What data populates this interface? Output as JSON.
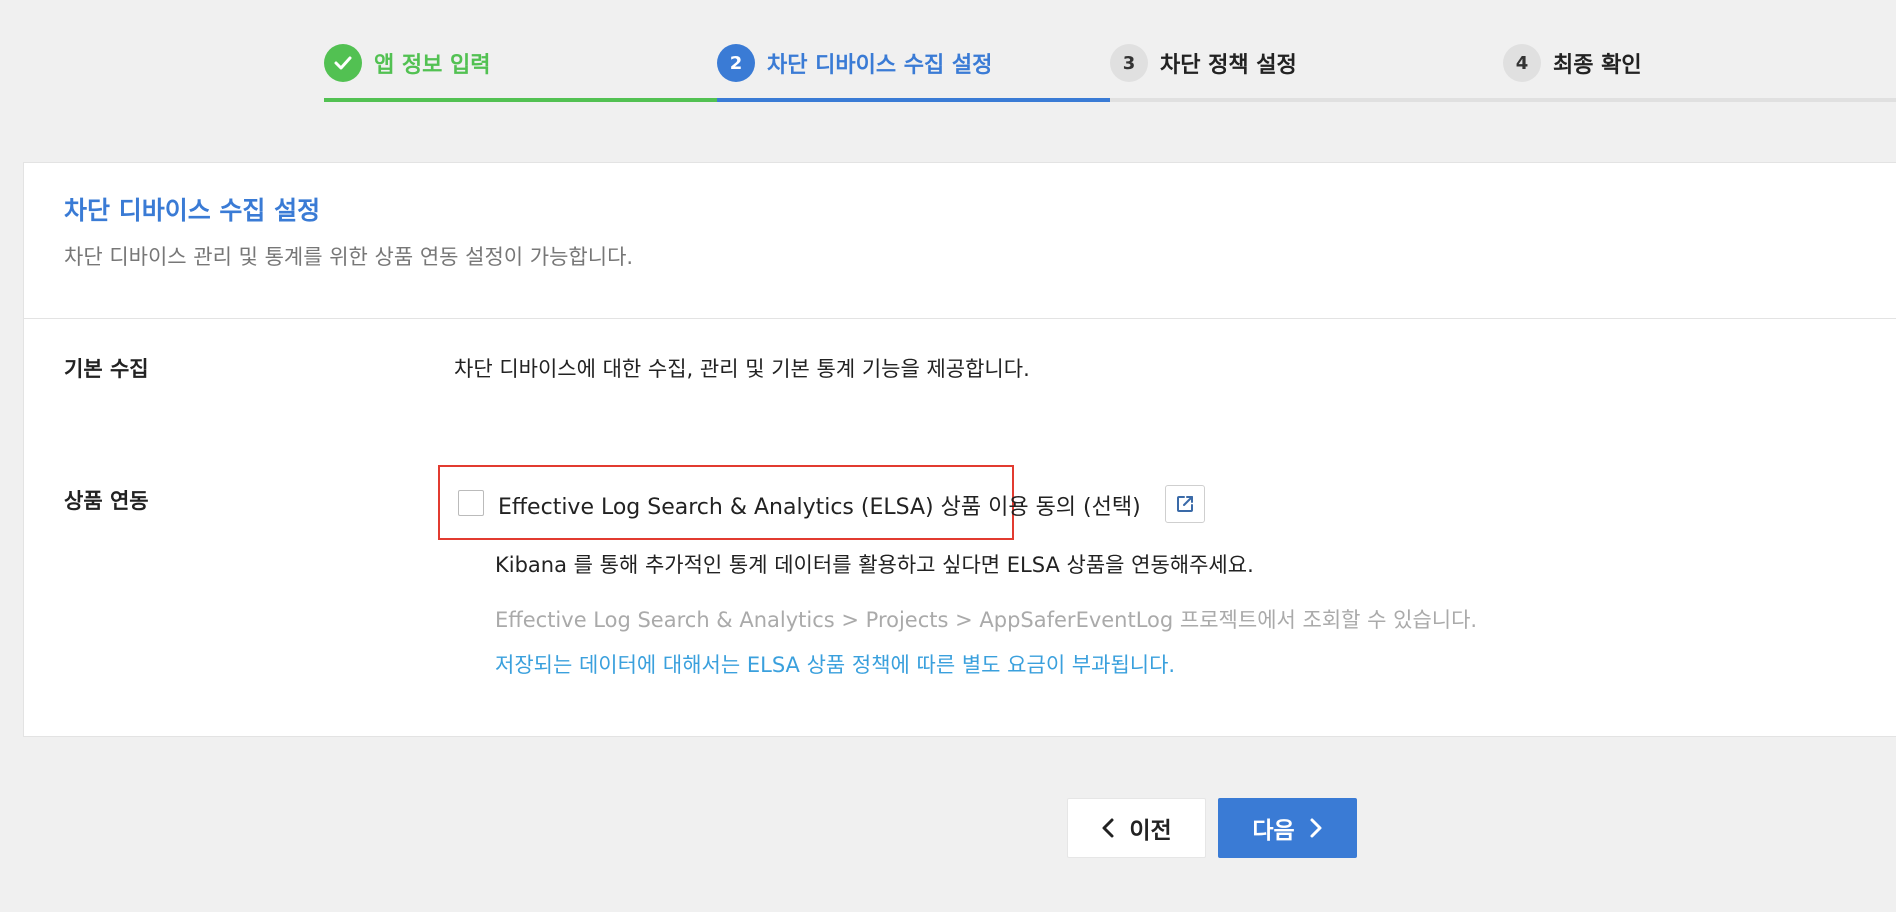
{
  "stepper": {
    "steps": [
      {
        "number": "1",
        "label": "앱 정보 입력",
        "state": "done"
      },
      {
        "number": "2",
        "label": "차단 디바이스 수집 설정",
        "state": "active"
      },
      {
        "number": "3",
        "label": "차단 정책 설정",
        "state": "pending"
      },
      {
        "number": "4",
        "label": "최종 확인",
        "state": "pending"
      }
    ]
  },
  "card": {
    "title": "차단 디바이스 수집 설정",
    "description": "차단 디바이스 관리 및 통계를 위한 상품 연동 설정이 가능합니다.",
    "basic": {
      "label": "기본 수집",
      "text": "차단 디바이스에 대한 수집, 관리 및 기본 통계 기능을 제공합니다."
    },
    "integration": {
      "label": "상품 연동",
      "consent_label": "Effective Log Search & Analytics (ELSA) 상품 이용 동의 (선택)",
      "consent_checked": false,
      "kibana_text": "Kibana 를 통해 추가적인 통계 데이터를 활용하고 싶다면 ELSA 상품을 연동해주세요.",
      "path_text": "Effective Log Search & Analytics > Projects > AppSaferEventLog 프로젝트에서 조회할 수 있습니다.",
      "fee_text": "저장되는 데이터에 대해서는 ELSA 상품 정책에 따른 별도 요금이 부과됩니다."
    }
  },
  "buttons": {
    "prev_label": "이전",
    "next_label": "다음"
  },
  "colors": {
    "done": "#52c152",
    "active": "#3a7bd5",
    "highlight_border": "#e23b30",
    "info_blue": "#3aa0dd"
  },
  "icons": {
    "done_step": "check-icon",
    "external_link": "external-link-icon",
    "prev": "chevron-left-icon",
    "next": "chevron-right-icon"
  }
}
